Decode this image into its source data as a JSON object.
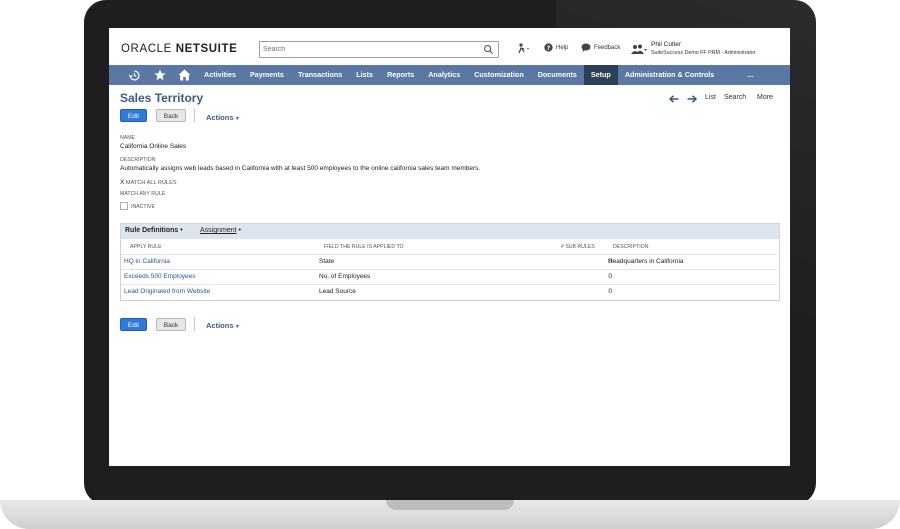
{
  "header": {
    "logo_oracle": "ORACLE",
    "logo_netsuite": "NETSUITE",
    "search_placeholder": "Search",
    "help": "Help",
    "feedback": "Feedback",
    "user_name": "Phil Cutler",
    "user_role": "SuiteSuccess Demo FF PRM - Administrator"
  },
  "nav": {
    "items": [
      "Activities",
      "Payments",
      "Transactions",
      "Lists",
      "Reports",
      "Analytics",
      "Customization",
      "Documents",
      "Setup",
      "Administration & Controls",
      "..."
    ],
    "active": "Setup",
    "color": "#5b78a4",
    "active_color": "#2e3f58"
  },
  "page": {
    "title": "Sales Territory",
    "right_nav": {
      "list": "List",
      "search": "Search",
      "more": "More"
    },
    "edit_label": "Edit",
    "back_label": "Back",
    "actions_label": "Actions"
  },
  "fields": {
    "name_label": "NAME",
    "name_value": "California Online Sales",
    "description_label": "DESCRIPTION",
    "description_value": "Automatically assigns web leads based in California with at least 500 employees to the online california sales team members.",
    "match_all": "MATCH ALL RULES",
    "match_all_mark": "X",
    "match_any": "MATCH ANY RULE",
    "inactive": "INACTIVE"
  },
  "subtabs": {
    "rule_definitions": "Rule Definitions",
    "assignment": "Assignment"
  },
  "rules_table": {
    "columns": [
      "APPLY RULE",
      "FIELD THE RULE IS APPLIED TO",
      "# SUB RULES",
      "DESCRIPTION"
    ],
    "rows": [
      {
        "rule": "HQ in California",
        "field": "State",
        "sub": "0",
        "desc": "Headquarters in California"
      },
      {
        "rule": "Exceeds 500 Employees",
        "field": "No. of Employees",
        "sub": "0",
        "desc": ""
      },
      {
        "rule": "Lead Originated from Website",
        "field": "Lead Source",
        "sub": "0",
        "desc": ""
      }
    ]
  }
}
